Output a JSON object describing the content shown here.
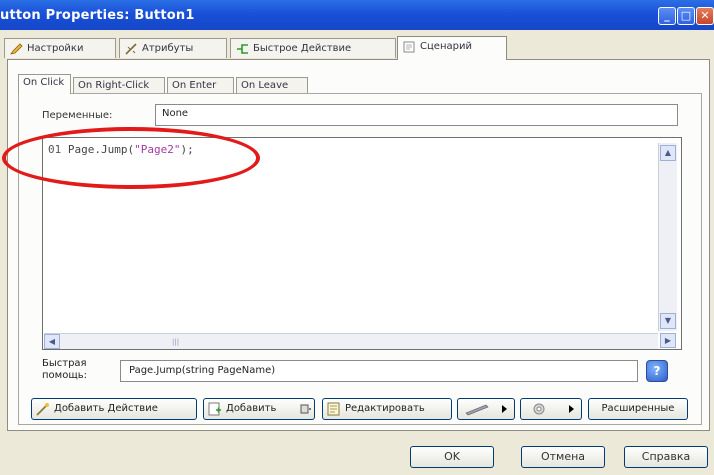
{
  "window": {
    "title": "utton Properties: Button1"
  },
  "top_tabs": [
    {
      "label": "Настройки",
      "icon": "pencil-icon"
    },
    {
      "label": "Атрибуты",
      "icon": "wand-icon"
    },
    {
      "label": "Быстрое Действие",
      "icon": "flow-arrow-icon"
    },
    {
      "label": "Сценарий",
      "icon": "script-icon"
    }
  ],
  "sub_tabs": [
    "On Click",
    "On Right-Click",
    "On Enter",
    "On Leave"
  ],
  "variables": {
    "label": "Переменные:",
    "value": "None"
  },
  "code": {
    "line_no": "01",
    "prefix": "Page.Jump(",
    "string": "\"Page2\"",
    "suffix": ");"
  },
  "quick_help": {
    "label_line1": "Быстрая",
    "label_line2": "помощь:",
    "value": "Page.Jump(string PageName)"
  },
  "action_buttons": {
    "add_action": "Добавить Действие",
    "add_code": "Добавить",
    "edit": "Редактировать",
    "advanced": "Расширенные"
  },
  "dialog_buttons": {
    "ok": "OK",
    "cancel": "Отмена",
    "help": "Справка"
  },
  "colors": {
    "title_bar": "#1950d8",
    "annotation": "#e21a1a",
    "string_literal": "#a33aa3"
  }
}
